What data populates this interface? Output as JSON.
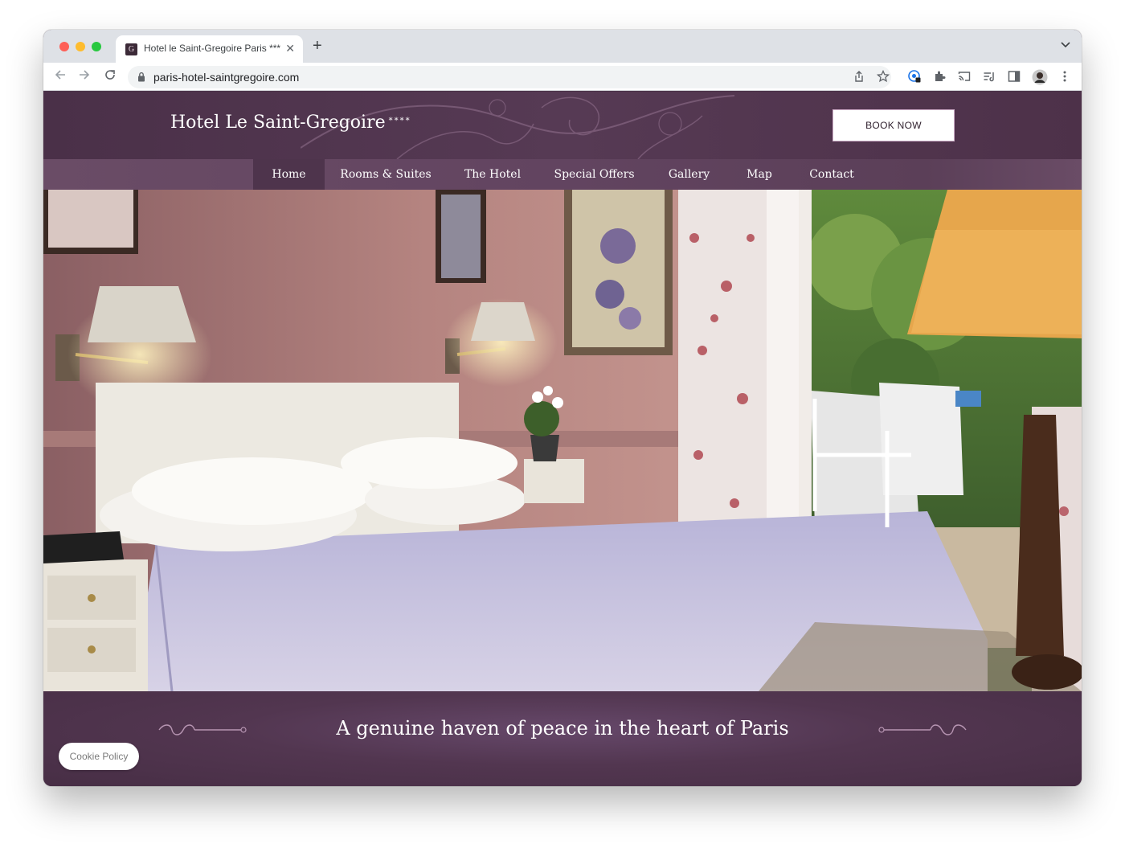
{
  "browser": {
    "tab_title": "Hotel le Saint-Gregoire Paris ****",
    "tab_favicon_letter": "G",
    "close_glyph": "✕",
    "new_tab_glyph": "+",
    "url": "paris-hotel-saintgregoire.com"
  },
  "site": {
    "logo_text": "Hotel Le Saint-Gregoire",
    "stars": "****",
    "book_now_label": "BOOK NOW"
  },
  "nav": {
    "items": [
      "Home",
      "Rooms & Suites",
      "The Hotel",
      "Special Offers",
      "Gallery",
      "Map",
      "Contact"
    ],
    "active": "Home"
  },
  "hero": {
    "tagline": "A genuine haven of peace in the heart of Paris"
  },
  "cookie": {
    "label": "Cookie Policy"
  },
  "colors": {
    "header_bg": "#4a3048",
    "nav_bg": "#6a4c66",
    "nav_active_bg": "#4e344c",
    "band_bg": "#523650"
  },
  "icons": [
    "lock-icon",
    "back-icon",
    "forward-icon",
    "reload-icon",
    "share-icon",
    "bookmark-star-icon",
    "extension-icon",
    "puzzle-icon",
    "cast-icon",
    "reading-list-icon",
    "side-panel-icon",
    "profile-avatar-icon",
    "more-menu-icon"
  ]
}
